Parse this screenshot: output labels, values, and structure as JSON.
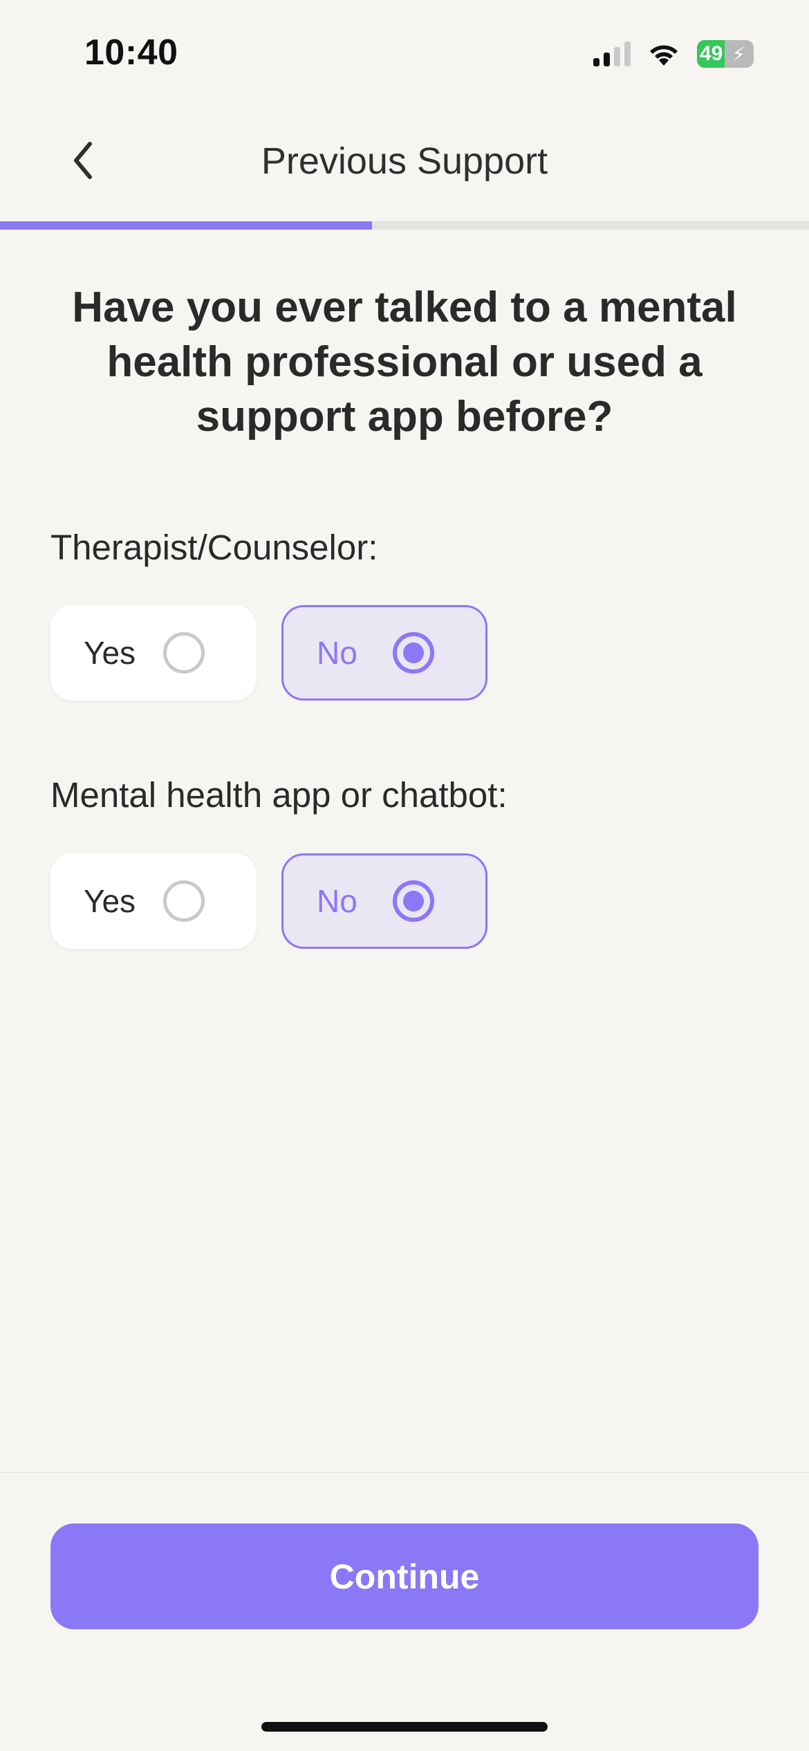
{
  "status_bar": {
    "time": "10:40",
    "battery": "49",
    "battery_level_percent": 49,
    "icons": [
      "cellular-signal-icon",
      "wifi-icon",
      "battery-charging-icon"
    ]
  },
  "header": {
    "title": "Previous Support",
    "back_icon": "chevron-left-icon"
  },
  "progress": {
    "fraction": 0.46
  },
  "question": "Have you ever talked to a mental health professional or used a support app before?",
  "sections": [
    {
      "label": "Therapist/Counselor:",
      "options": [
        {
          "label": "Yes",
          "selected": false
        },
        {
          "label": "No",
          "selected": true
        }
      ]
    },
    {
      "label": "Mental health app or chatbot:",
      "options": [
        {
          "label": "Yes",
          "selected": false
        },
        {
          "label": "No",
          "selected": true
        }
      ]
    }
  ],
  "footer": {
    "continue_label": "Continue"
  },
  "colors": {
    "accent": "#8B78F6",
    "background": "#F7F5F1",
    "selected_bg": "#EBE6F3",
    "battery_green": "#34C759"
  }
}
